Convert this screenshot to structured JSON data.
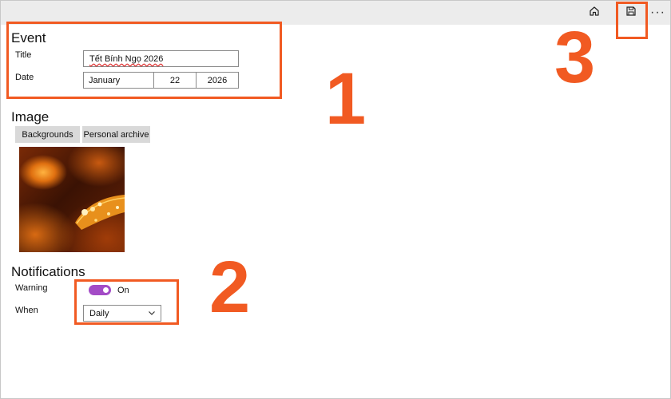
{
  "toolbar": {
    "home_icon": "home-icon",
    "save_icon": "save-icon",
    "more_label": "···"
  },
  "event": {
    "section_title": "Event",
    "title_label": "Title",
    "title_value": "Tết Bính Ngọ 2026",
    "date_label": "Date",
    "date": {
      "month": "January",
      "day": "22",
      "year": "2026"
    }
  },
  "image": {
    "section_title": "Image",
    "tabs": [
      "Backgrounds",
      "Personal archive"
    ]
  },
  "notifications": {
    "section_title": "Notifications",
    "warning_label": "Warning",
    "warning_state": "On",
    "warning_on": true,
    "when_label": "When",
    "when_value": "Daily"
  },
  "annotations": {
    "accent_color": "#f15a22",
    "markers": [
      "1",
      "2",
      "3"
    ]
  }
}
